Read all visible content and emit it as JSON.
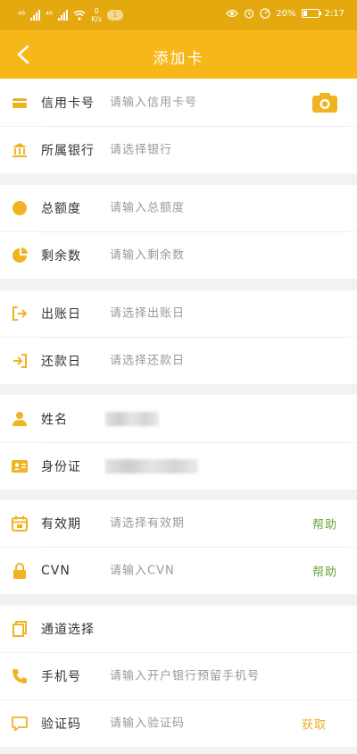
{
  "status_bar": {
    "signal_1": "⁴⁶",
    "signal_2": "⁴⁶",
    "speed": "0\nK/s",
    "notification_count": "1",
    "battery_percent": "20%",
    "time": "2:17",
    "icons": [
      "eye-icon",
      "alarm-icon",
      "speedometer-icon",
      "battery-icon"
    ]
  },
  "header": {
    "title": "添加卡",
    "back_icon": "chevron-left-icon"
  },
  "colors": {
    "status_bar": "#e4a90f",
    "header": "#f7b719",
    "icon": "#f0b322",
    "help": "#6aa535",
    "get": "#e7b022",
    "background": "#f2f2f2"
  },
  "form": {
    "credit_card": {
      "label": "信用卡号",
      "placeholder": "请输入信用卡号",
      "icon": "credit-card-icon",
      "action_icon": "camera-icon"
    },
    "bank": {
      "label": "所属银行",
      "placeholder": "请选择银行",
      "icon": "bank-icon"
    },
    "total_limit": {
      "label": "总额度",
      "placeholder": "请输入总额度",
      "icon": "circle-icon"
    },
    "remaining": {
      "label": "剩余数",
      "placeholder": "请输入剩余数",
      "icon": "pie-chart-icon"
    },
    "statement_day": {
      "label": "出账日",
      "placeholder": "请选择出账日",
      "icon": "logout-icon"
    },
    "repayment_day": {
      "label": "还款日",
      "placeholder": "请选择还款日",
      "icon": "login-icon"
    },
    "name": {
      "label": "姓名",
      "icon": "user-icon"
    },
    "id_card": {
      "label": "身份证",
      "icon": "id-card-icon"
    },
    "expiry": {
      "label": "有效期",
      "placeholder": "请选择有效期",
      "icon": "calendar-icon",
      "action": "帮助"
    },
    "cvn": {
      "label": "CVN",
      "placeholder": "请输入CVN",
      "icon": "lock-icon",
      "action": "帮助"
    },
    "channel": {
      "label": "通道选择",
      "icon": "copy-icon"
    },
    "phone": {
      "label": "手机号",
      "placeholder": "请输入开户银行预留手机号",
      "icon": "phone-icon"
    },
    "code": {
      "label": "验证码",
      "placeholder": "请输入验证码",
      "icon": "message-icon",
      "action": "获取"
    }
  }
}
